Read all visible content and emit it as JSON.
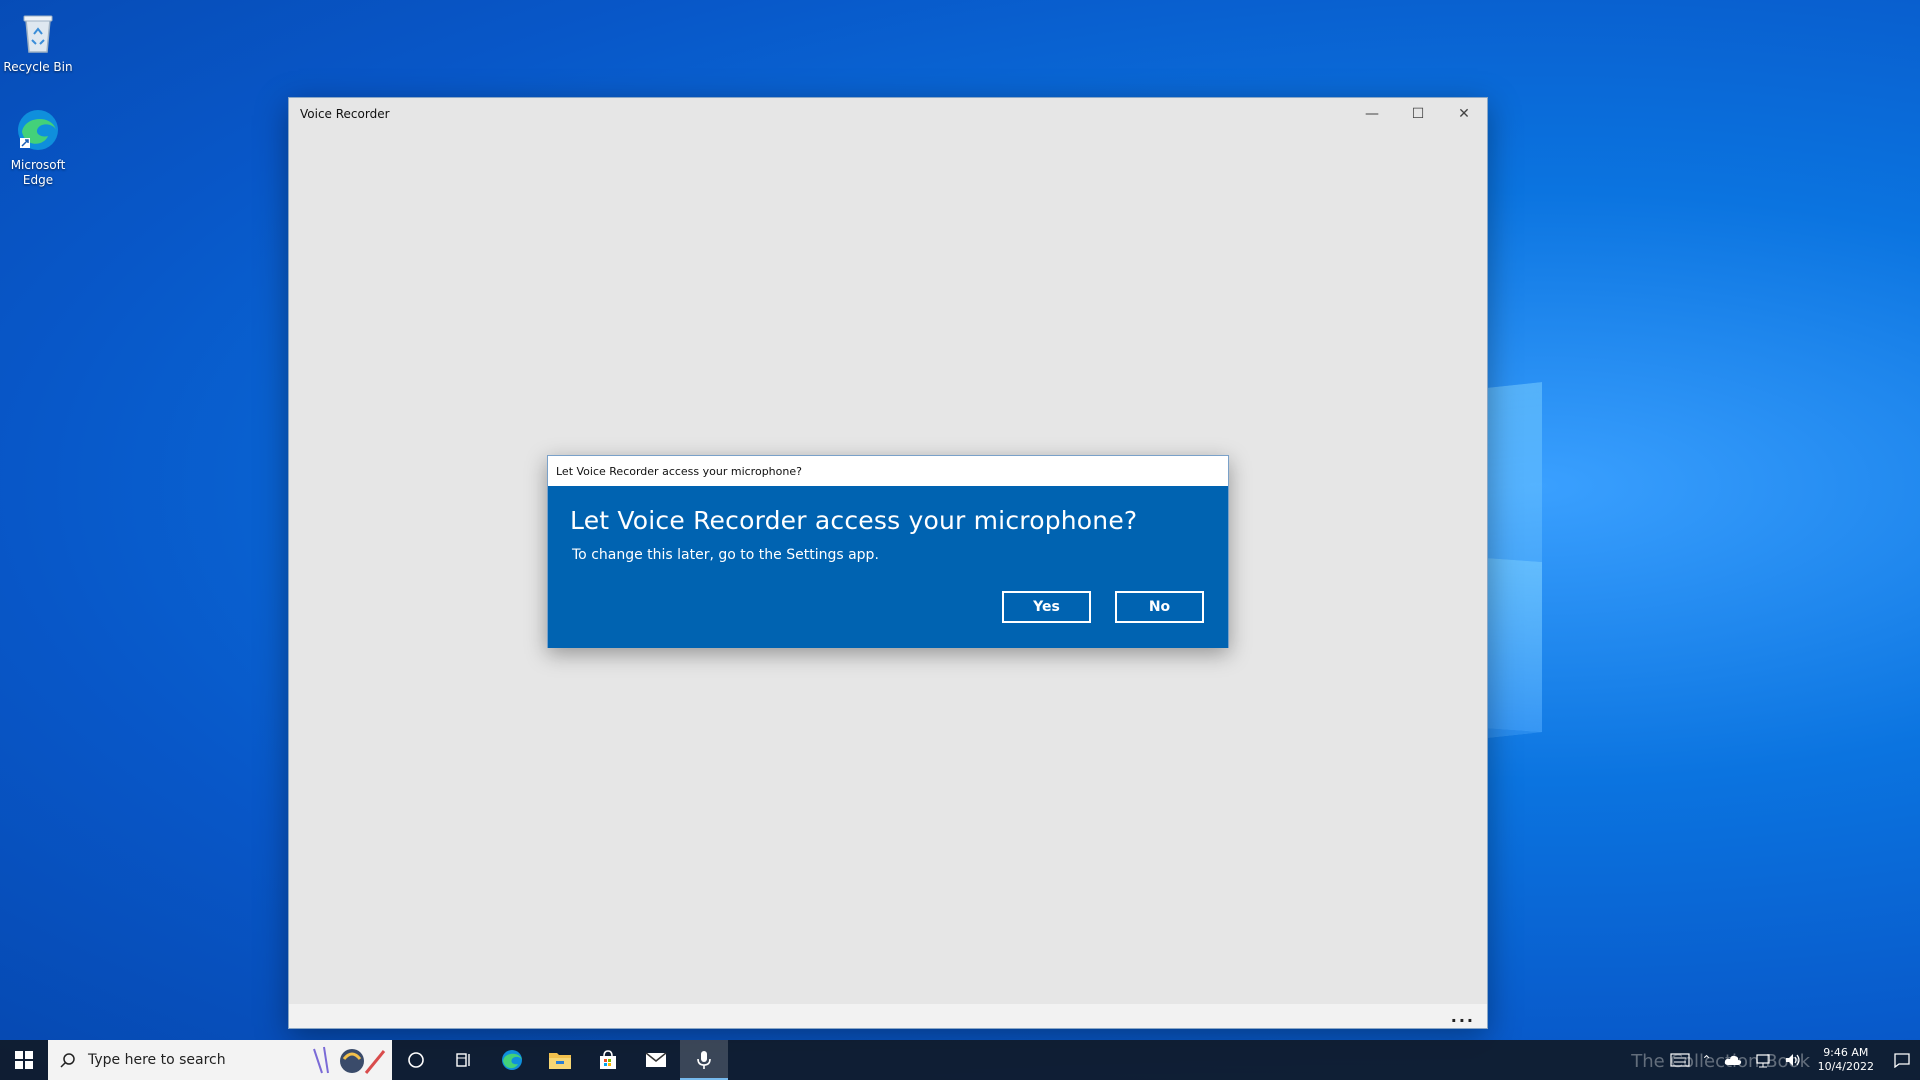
{
  "desktop": {
    "icons": [
      {
        "label": "Recycle Bin"
      },
      {
        "label": "Microsoft Edge"
      }
    ]
  },
  "window": {
    "title": "Voice Recorder",
    "controls": {
      "minimize": "—",
      "maximize": "☐",
      "close": "✕"
    },
    "more_label": "..."
  },
  "dialog": {
    "titlebar": "Let Voice Recorder access your microphone?",
    "heading": "Let Voice Recorder access your microphone?",
    "subtext": "To change this later, go to the Settings app.",
    "yes_label": "Yes",
    "no_label": "No"
  },
  "taskbar": {
    "search_placeholder": "Type here to search",
    "apps": [
      "cortana-icon",
      "task-view-icon",
      "edge-icon",
      "file-explorer-icon",
      "store-icon",
      "mail-icon",
      "voice-recorder-icon"
    ],
    "time": "9:46 AM",
    "date": "10/4/2022",
    "watermark": "The Collection Book"
  },
  "colors": {
    "dialog_blue": "#0063b1",
    "window_bg": "#e6e6e6",
    "taskbar_bg": "#101a28"
  }
}
